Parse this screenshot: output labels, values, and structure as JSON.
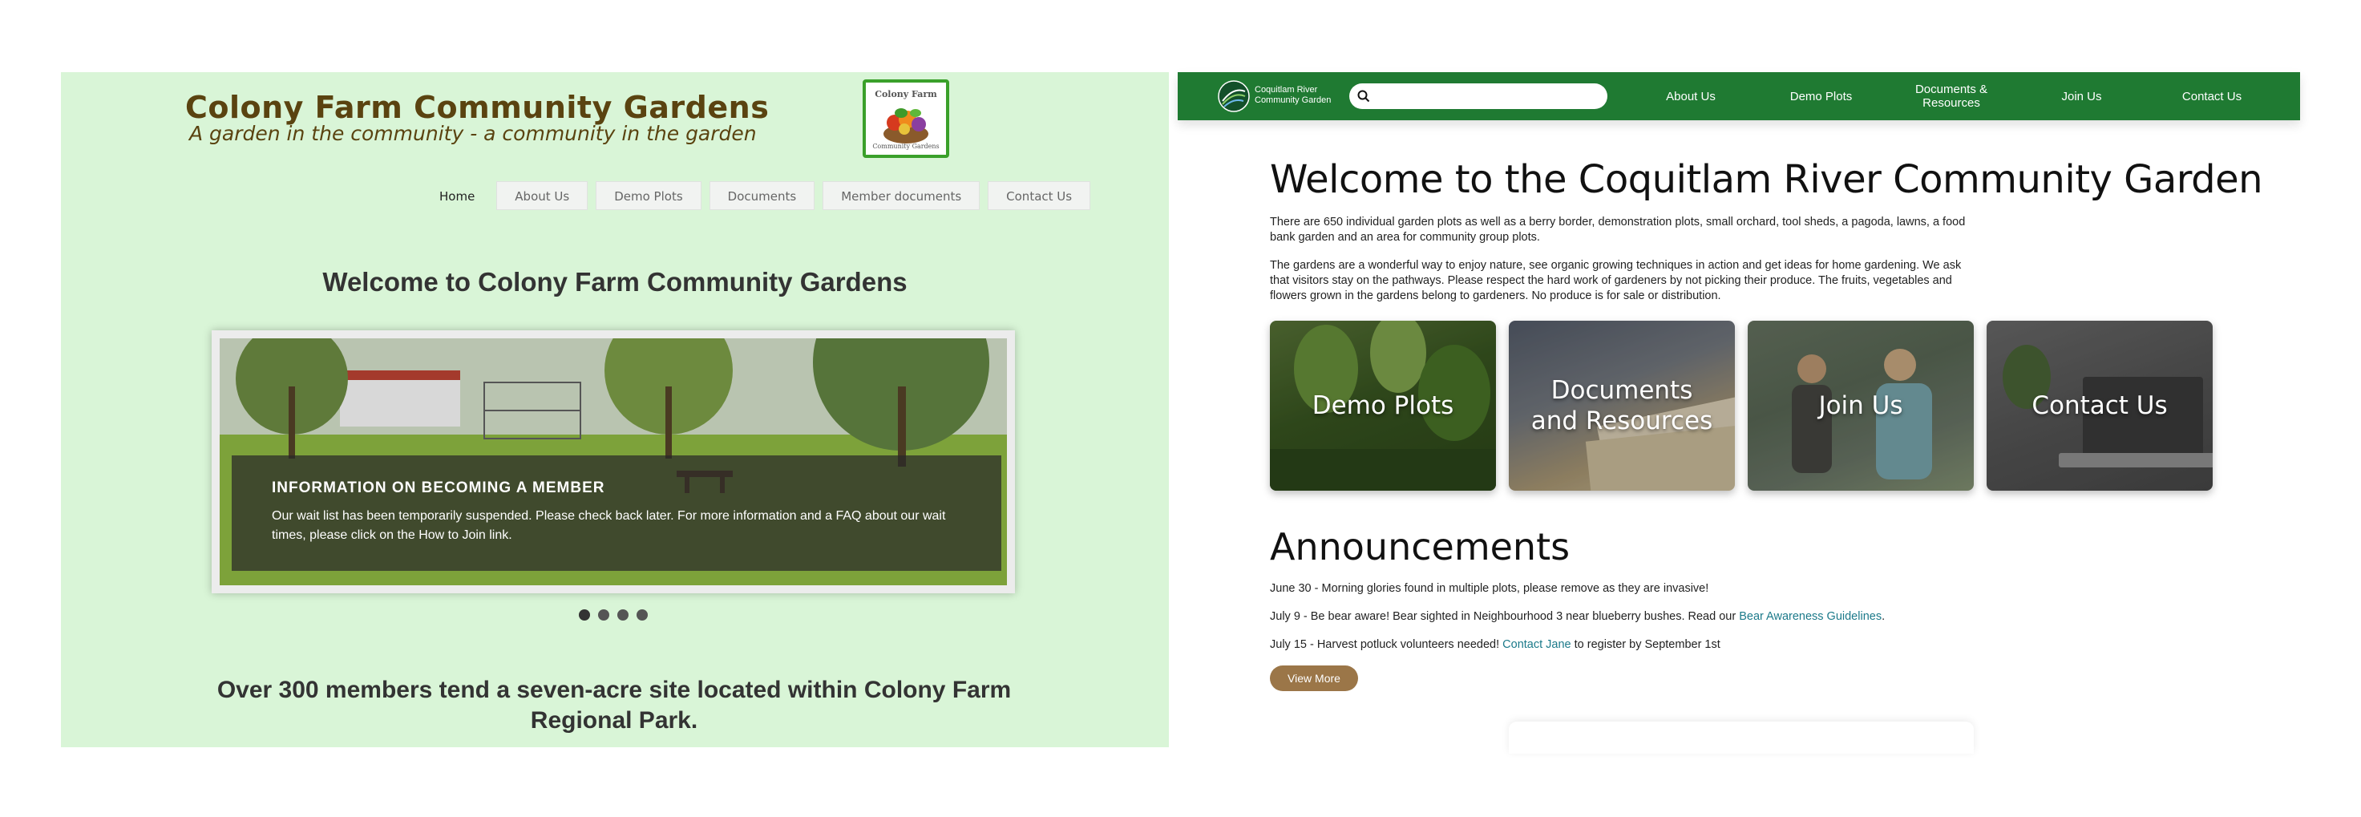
{
  "colony_farm": {
    "site_title": "Colony Farm Community Gardens",
    "tagline": "A garden in the community - a community in the garden",
    "logo": {
      "top_text": "Colony Farm",
      "bottom_text": "Community Gardens",
      "icon": "vegetable-basket-logo"
    },
    "nav": [
      "Home",
      "About Us",
      "Demo Plots",
      "Documents",
      "Member documents",
      "Contact Us"
    ],
    "active_nav": "Home",
    "welcome": "Welcome to Colony Farm Community Gardens",
    "slider": {
      "caption_title": "INFORMATION ON BECOMING A MEMBER",
      "caption_text": "Our wait list has been temporarily suspended. Please check back later. For more information and a FAQ about our wait times, please click on the How to Join link.",
      "slide_count": 4,
      "active_index": 0
    },
    "members_text": "Over 300 members tend a seven-acre site located within Colony Farm Regional Park.",
    "colors": {
      "background": "#d9f5d7",
      "title": "#5a4310",
      "logo_border": "#3aa02a"
    }
  },
  "coquitlam": {
    "brand": "Coquitlam River\nCommunity Garden",
    "search": {
      "placeholder": "",
      "icon": "search-icon"
    },
    "nav": [
      "About Us",
      "Demo Plots",
      "Documents &\nResources",
      "Join Us",
      "Contact Us"
    ],
    "title": "Welcome to the Coquitlam River Community Garden",
    "paragraphs": [
      "There are 650 individual garden plots as well as a berry border, demonstration plots, small orchard, tool sheds, a pagoda, lawns, a food bank garden and an area for community group plots.",
      "The gardens are a wonderful way to enjoy nature, see organic growing techniques in action and get ideas for home gardening. We ask that visitors stay on the pathways. Please respect the hard work of gardeners by not picking their produce. The fruits, vegetables and flowers grown in the gardens belong to gardeners. No produce is for sale or distribution."
    ],
    "cards": [
      "Demo Plots",
      "Documents and Resources",
      "Join Us",
      "Contact Us"
    ],
    "announcements_title": "Announcements",
    "announcements": [
      {
        "text": "June 30 - Morning glories found in multiple plots, please remove as they are invasive!"
      },
      {
        "text": "July 9 - Be bear aware! Bear sighted in Neighbourhood 3 near blueberry bushes. Read our ",
        "link": "Bear Awareness Guidelines",
        "after": "."
      },
      {
        "text": "July 15 - Harvest potluck volunteers needed! ",
        "link": "Contact Jane",
        "after": " to register by September 1st"
      }
    ],
    "view_more": "View More",
    "colors": {
      "header": "#1f7a32",
      "link": "#1c7a8a",
      "button": "#9b7648"
    }
  }
}
